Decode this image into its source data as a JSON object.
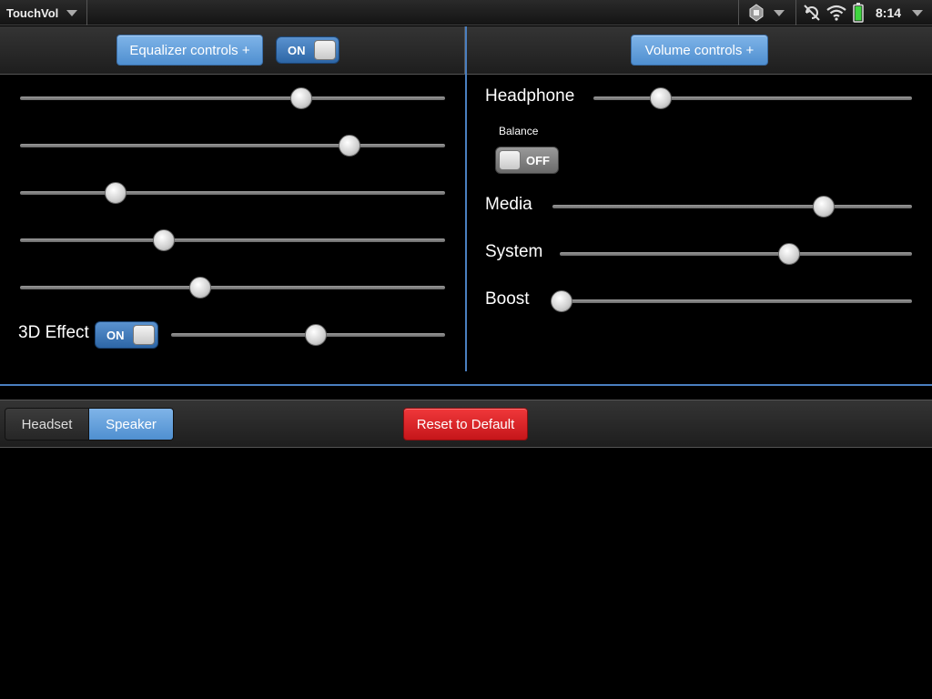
{
  "statusbar": {
    "app_name": "TouchVol",
    "clock": "8:14",
    "icons": [
      "app-menu-caret-icon",
      "notification-icon",
      "rotation-lock-icon",
      "wifi-icon",
      "battery-icon"
    ]
  },
  "equalizer": {
    "button_label": "Equalizer controls +",
    "toggle_label": "ON",
    "bands": [
      0.67,
      0.79,
      0.21,
      0.33,
      0.42
    ],
    "effect_3d": {
      "label": "3D Effect",
      "toggle_label": "ON",
      "value": 0.53
    }
  },
  "volume": {
    "button_label": "Volume controls +",
    "headphone": {
      "label": "Headphone",
      "value": 0.19
    },
    "balance": {
      "label": "Balance",
      "toggle_label": "OFF"
    },
    "media": {
      "label": "Media",
      "value": 0.77
    },
    "system": {
      "label": "System",
      "value": 0.66
    },
    "boost": {
      "label": "Boost",
      "value": 0.0
    }
  },
  "bottombar": {
    "segments": [
      {
        "label": "Headset",
        "selected": false
      },
      {
        "label": "Speaker",
        "selected": true
      }
    ],
    "reset_label": "Reset to Default"
  },
  "colors": {
    "accent_blue": "#5a92cf",
    "divider_blue": "#4a7fc0",
    "reset_red": "#d9262a"
  }
}
